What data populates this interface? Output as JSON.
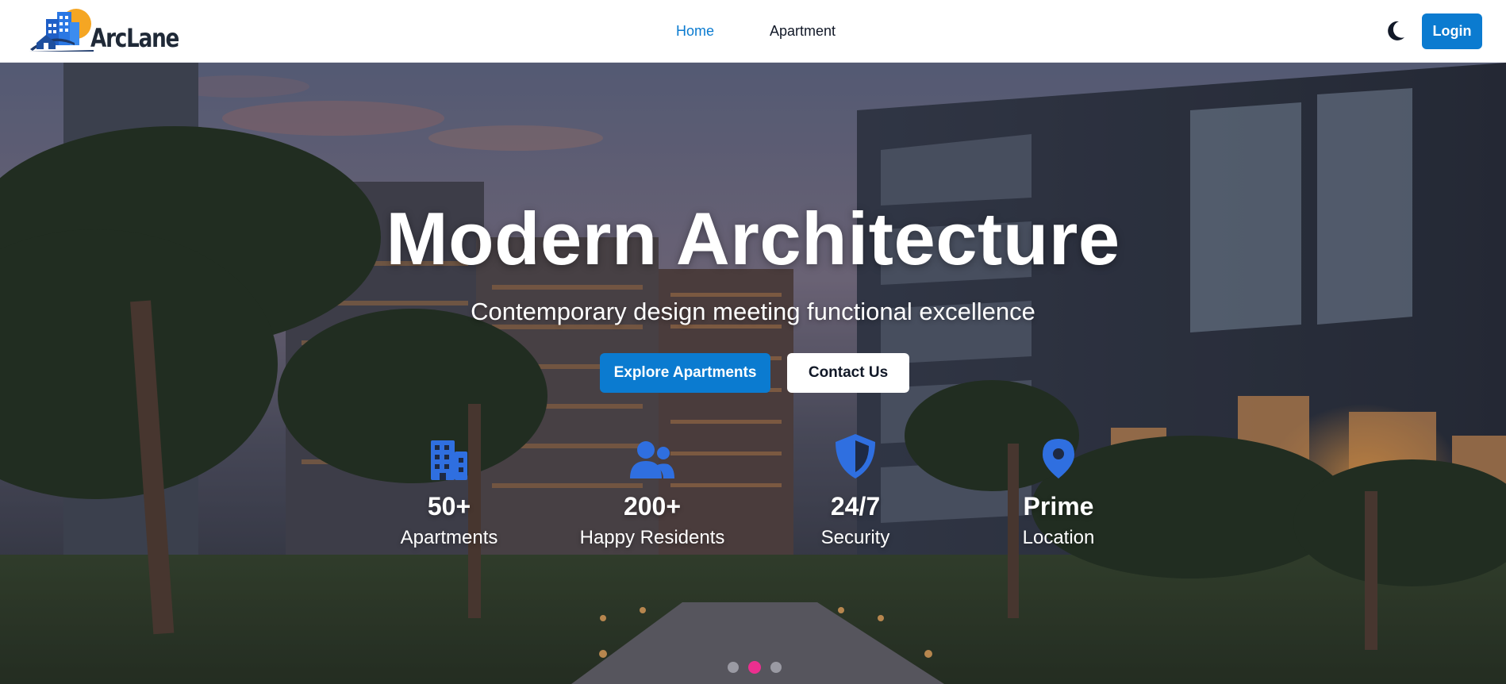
{
  "brand": {
    "name": "ArcLane"
  },
  "nav": {
    "links": [
      {
        "label": "Home",
        "active": true
      },
      {
        "label": "Apartment",
        "active": false
      }
    ],
    "theme_toggle_icon": "moon-icon",
    "login_label": "Login"
  },
  "hero": {
    "title": "Modern Architecture",
    "subtitle": "Contemporary design meeting functional excellence",
    "primary_button": "Explore Apartments",
    "secondary_button": "Contact Us",
    "stats": [
      {
        "icon": "building-icon",
        "value": "50+",
        "label": "Apartments"
      },
      {
        "icon": "users-icon",
        "value": "200+",
        "label": "Happy Residents"
      },
      {
        "icon": "shield-icon",
        "value": "24/7",
        "label": "Security"
      },
      {
        "icon": "map-pin-icon",
        "value": "Prime",
        "label": "Location"
      }
    ],
    "carousel": {
      "slide_count": 3,
      "active_index": 1
    }
  },
  "colors": {
    "accent": "#0b7bd0",
    "stat_icon": "#2f6fe0",
    "carousel_active": "#ec2f8f",
    "logo_sun": "#f5a623"
  }
}
